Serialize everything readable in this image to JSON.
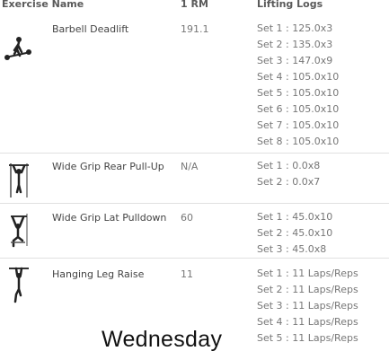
{
  "table": {
    "headers": {
      "exercise": "Exercise Name",
      "rm": "1 RM",
      "logs": "Lifting Logs"
    },
    "rows": [
      {
        "name": "Barbell Deadlift",
        "rm": "191.1",
        "sets": [
          "Set 1 : 125.0x3",
          "Set 2 : 135.0x3",
          "Set 3 : 147.0x9",
          "Set 4 : 105.0x10",
          "Set 5 : 105.0x10",
          "Set 6 : 105.0x10",
          "Set 7 : 105.0x10",
          "Set 8 : 105.0x10"
        ]
      },
      {
        "name": "Wide Grip Rear Pull-Up",
        "rm": "N/A",
        "sets": [
          "Set 1 : 0.0x8",
          "Set 2 : 0.0x7"
        ]
      },
      {
        "name": "Wide Grip Lat Pulldown",
        "rm": "60",
        "sets": [
          "Set 1 : 45.0x10",
          "Set 2 : 45.0x10",
          "Set 3 : 45.0x8"
        ]
      },
      {
        "name": "Hanging Leg Raise",
        "rm": "11",
        "sets": [
          "Set 1 : 11 Laps/Reps",
          "Set 2 : 11 Laps/Reps",
          "Set 3 : 11 Laps/Reps",
          "Set 4 : 11 Laps/Reps",
          "Set 5 : 11 Laps/Reps"
        ]
      }
    ]
  },
  "day_label": "Wednesday",
  "icons": [
    "deadlift-figure-icon",
    "pull-up-figure-icon",
    "lat-pulldown-figure-icon",
    "leg-raise-figure-icon"
  ]
}
